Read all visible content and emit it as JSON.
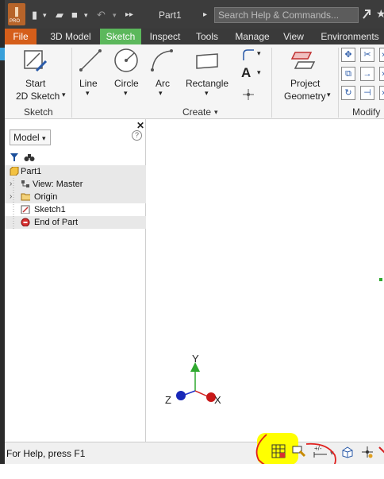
{
  "titlebar": {
    "logo_label": "PRO",
    "doc_title": "Part1",
    "search_placeholder": "Search Help & Commands...",
    "more_glyph": "▸▸"
  },
  "tabs": [
    {
      "label": "File"
    },
    {
      "label": "3D Model"
    },
    {
      "label": "Sketch"
    },
    {
      "label": "Inspect"
    },
    {
      "label": "Tools"
    },
    {
      "label": "Manage"
    },
    {
      "label": "View"
    },
    {
      "label": "Environments"
    }
  ],
  "ribbon": {
    "start_sketch": {
      "line1": "Start",
      "line2": "2D Sketch"
    },
    "sketch_panel_title": "Sketch",
    "line_label": "Line",
    "circle_label": "Circle",
    "arc_label": "Arc",
    "rectangle_label": "Rectangle",
    "create_panel_title": "Create",
    "project_geometry": {
      "line1": "Project",
      "line2": "Geometry"
    },
    "modify_panel_title": "Modify",
    "text_icon_glyph": "A",
    "dropdown_glyph": "▾"
  },
  "browser": {
    "close_glyph": "✕",
    "model_dropdown": "Model",
    "help_glyph": "?",
    "tree": [
      {
        "label": "Part1",
        "shaded": true
      },
      {
        "label": "View: Master",
        "shaded": true
      },
      {
        "label": "Origin",
        "shaded": true
      },
      {
        "label": "Sketch1",
        "shaded": false
      },
      {
        "label": "End of Part",
        "shaded": true
      }
    ]
  },
  "viewport": {
    "axis_x": "X",
    "axis_y": "Y",
    "axis_z": "Z",
    "colors": {
      "x": "#d42020",
      "y": "#2ea82e",
      "z": "#2030c8"
    }
  },
  "statusbar": {
    "help_text": "For Help, press F1"
  },
  "annotation": {
    "highlight_color": "#ffff00",
    "circle_color": "#e0201e"
  }
}
